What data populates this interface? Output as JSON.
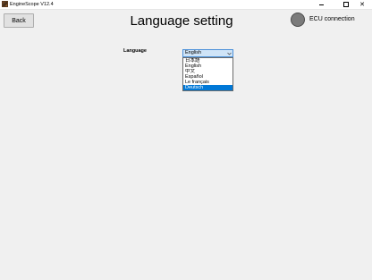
{
  "window": {
    "title": "EngineScope V12.4",
    "minimize_glyph": "",
    "maximize_glyph": "",
    "close_glyph": "✕"
  },
  "header": {
    "back_label": "Back",
    "page_title": "Language setting",
    "ecu_label": "ECU connection",
    "ecu_indicator_color": "#7b7b7b"
  },
  "language": {
    "label": "Language",
    "selected_value": "English",
    "options": [
      "日本語",
      "English",
      "中文",
      "Español",
      "Le français",
      "Deutsch"
    ],
    "highlighted_option": "Deutsch"
  },
  "colors": {
    "accent": "#0078d7",
    "select_bg": "#cfe4f7",
    "select_border": "#4a90d9"
  }
}
